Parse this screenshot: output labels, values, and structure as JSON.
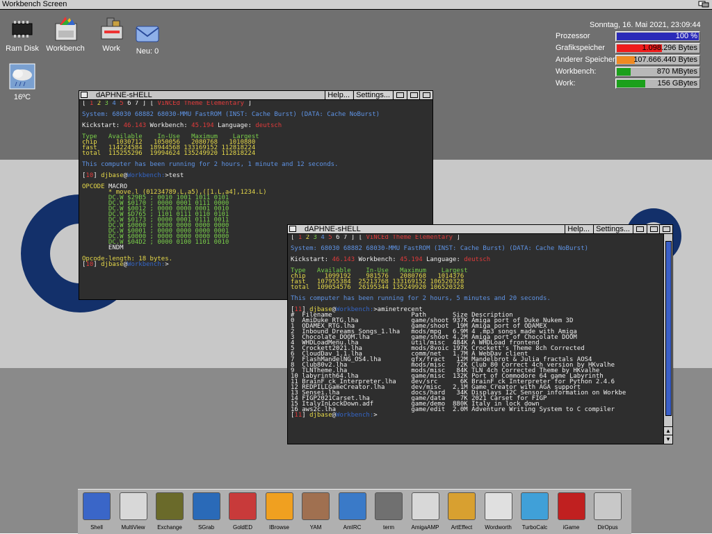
{
  "screen": {
    "title": "Workbench Screen"
  },
  "desktop_icons": [
    {
      "label": "Ram Disk",
      "icon": "ramdisk-chip-icon"
    },
    {
      "label": "Workbench",
      "icon": "workbench-disk-icon"
    },
    {
      "label": "Work",
      "icon": "work-harddisk-icon"
    },
    {
      "label": "Neu: 0",
      "icon": "mail-envelope-icon"
    },
    {
      "label": "16ºC",
      "icon": "weather-cloud-icon"
    }
  ],
  "monitor": {
    "datetime": "Sonntag, 16. Mai 2021, 23:09:44",
    "rows": [
      {
        "label": "Prozessor",
        "value": "100 %",
        "fill": 1.0,
        "color": "#2b2bb8"
      },
      {
        "label": "Grafikspeicher",
        "value": "1.098.296 Bytes",
        "fill": 0.55,
        "color": "#ef1b1b"
      },
      {
        "label": "Anderer Speicher",
        "value": "107.666.440 Bytes",
        "fill": 0.22,
        "color": "#f08a22"
      },
      {
        "label": "Workbench:",
        "value": "870 MBytes",
        "fill": 0.17,
        "color": "#1ba01b"
      },
      {
        "label": "Work:",
        "value": "156 GBytes",
        "fill": 0.35,
        "color": "#1ba01b"
      }
    ]
  },
  "windows": [
    {
      "title": "dAPHNE-sHELL",
      "help": "Help...",
      "settings": "Settings...",
      "lines": [
        {
          "segs": [
            [
              "[ ",
              "c-wht"
            ],
            [
              "1 ",
              "c-red"
            ],
            [
              "2 ",
              "c-yel"
            ],
            [
              "3 ",
              "c-grn"
            ],
            [
              "4 ",
              "c-blue"
            ],
            [
              "5 ",
              "c-red"
            ],
            [
              "6 ",
              "c-wht"
            ],
            [
              "7 ",
              "c-wht"
            ],
            [
              "] [ ",
              "c-wht"
            ],
            [
              "ViNCEd Theme Elementary",
              "c-red"
            ],
            [
              " ]",
              "c-wht"
            ]
          ]
        },
        {
          "segs": [
            [
              "",
              ""
            ]
          ]
        },
        {
          "segs": [
            [
              "System: 68030 68882 68030-MMU FastROM (INST: Cache Burst) (DATA: Cache NoBurst)",
              "c-blue"
            ]
          ]
        },
        {
          "segs": [
            [
              "",
              ""
            ]
          ]
        },
        {
          "segs": [
            [
              "Kickstart: ",
              "c-wht"
            ],
            [
              "46.143",
              "c-red"
            ],
            [
              " Workbench: ",
              "c-wht"
            ],
            [
              "45.194",
              "c-red"
            ],
            [
              " Language: ",
              "c-wht"
            ],
            [
              "deutsch",
              "c-red"
            ]
          ]
        },
        {
          "segs": [
            [
              "",
              ""
            ]
          ]
        },
        {
          "segs": [
            [
              "Type   Available    In-Use   Maximum    Largest",
              "c-grn"
            ]
          ]
        },
        {
          "segs": [
            [
              "chip     1030712   1050056   2080768   1010880",
              "c-yel"
            ]
          ]
        },
        {
          "segs": [
            [
              "fast   114224584  18944568 133169152 112818224",
              "c-yel"
            ]
          ]
        },
        {
          "segs": [
            [
              "total  115255296  19994624 135249920 112818224",
              "c-yel"
            ]
          ]
        },
        {
          "segs": [
            [
              "",
              ""
            ]
          ]
        },
        {
          "segs": [
            [
              "This computer has been running for 2 hours, 1 minute and 12 seconds.",
              "c-blue"
            ]
          ]
        },
        {
          "segs": [
            [
              "",
              ""
            ]
          ]
        },
        {
          "segs": [
            [
              "[",
              "c-wht"
            ],
            [
              "10",
              "c-red"
            ],
            [
              "] ",
              "c-wht"
            ],
            [
              "djbase",
              "c-yel"
            ],
            [
              "@",
              "c-wht"
            ],
            [
              "Workbench:",
              "c-dblue"
            ],
            [
              ">test",
              "c-wht"
            ]
          ]
        },
        {
          "segs": [
            [
              "",
              ""
            ]
          ]
        },
        {
          "segs": [
            [
              "OPCODE ",
              "c-yel"
            ],
            [
              "MACRO",
              "c-wht"
            ]
          ]
        },
        {
          "segs": [
            [
              "       * move.l (01234789.L,a5),([1.L,a4],1234.L)",
              "c-yel"
            ]
          ]
        },
        {
          "segs": [
            [
              "       DC.W $29B5 ; 0010 1001 1011 0101",
              "c-grn"
            ]
          ]
        },
        {
          "segs": [
            [
              "       DC.W $0170 ; 0000 0001 0111 0000",
              "c-grn"
            ]
          ]
        },
        {
          "segs": [
            [
              "       DC.W $0012 ; 0000 0000 0001 0010",
              "c-grn"
            ]
          ]
        },
        {
          "segs": [
            [
              "       DC.W $D765 ; 1101 0111 0110 0101",
              "c-grn"
            ]
          ]
        },
        {
          "segs": [
            [
              "       DC.W $0173 ; 0000 0001 0111 0011",
              "c-grn"
            ]
          ]
        },
        {
          "segs": [
            [
              "       DC.W $0000 ; 0000 0000 0000 0000",
              "c-grn"
            ]
          ]
        },
        {
          "segs": [
            [
              "       DC.W $0001 ; 0000 0000 0000 0001",
              "c-grn"
            ]
          ]
        },
        {
          "segs": [
            [
              "       DC.W $0000 ; 0000 0000 0000 0000",
              "c-grn"
            ]
          ]
        },
        {
          "segs": [
            [
              "       DC.W $04D2 ; 0000 0100 1101 0010",
              "c-grn"
            ]
          ]
        },
        {
          "segs": [
            [
              "       ENDM",
              "c-wht"
            ]
          ]
        },
        {
          "segs": [
            [
              "",
              ""
            ]
          ]
        },
        {
          "segs": [
            [
              "Opcode-length: ",
              "c-yel"
            ],
            [
              "18 bytes.",
              "c-yel"
            ]
          ]
        },
        {
          "segs": [
            [
              "[",
              "c-wht"
            ],
            [
              "10",
              "c-red"
            ],
            [
              "] ",
              "c-wht"
            ],
            [
              "djbase",
              "c-yel"
            ],
            [
              "@",
              "c-wht"
            ],
            [
              "Workbench:",
              "c-dblue"
            ],
            [
              ">",
              "c-wht"
            ]
          ]
        }
      ]
    },
    {
      "title": "dAPHNE-sHELL",
      "help": "Help...",
      "settings": "Settings...",
      "lines": [
        {
          "segs": [
            [
              "[ ",
              "c-wht"
            ],
            [
              "1 ",
              "c-red"
            ],
            [
              "2 ",
              "c-yel"
            ],
            [
              "3 ",
              "c-grn"
            ],
            [
              "4 ",
              "c-blue"
            ],
            [
              "5 ",
              "c-red"
            ],
            [
              "6 ",
              "c-wht"
            ],
            [
              "7 ",
              "c-wht"
            ],
            [
              "] [ ",
              "c-wht"
            ],
            [
              "ViNCEd Theme Elementary",
              "c-red"
            ],
            [
              " ]",
              "c-wht"
            ]
          ]
        },
        {
          "segs": [
            [
              "",
              ""
            ]
          ]
        },
        {
          "segs": [
            [
              "System: 68030 68882 68030-MMU FastROM (INST: Cache Burst) (DATA: Cache NoBurst)",
              "c-blue"
            ]
          ]
        },
        {
          "segs": [
            [
              "",
              ""
            ]
          ]
        },
        {
          "segs": [
            [
              "Kickstart: ",
              "c-wht"
            ],
            [
              "46.143",
              "c-red"
            ],
            [
              " Workbench: ",
              "c-wht"
            ],
            [
              "45.194",
              "c-red"
            ],
            [
              " Language: ",
              "c-wht"
            ],
            [
              "deutsch",
              "c-red"
            ]
          ]
        },
        {
          "segs": [
            [
              "",
              ""
            ]
          ]
        },
        {
          "segs": [
            [
              "Type   Available    In-Use   Maximum    Largest",
              "c-grn"
            ]
          ]
        },
        {
          "segs": [
            [
              "chip     1099192    981576   2080768   1014376",
              "c-yel"
            ]
          ]
        },
        {
          "segs": [
            [
              "fast   107955384  25213768 133169152 106520328",
              "c-yel"
            ]
          ]
        },
        {
          "segs": [
            [
              "total  109054576  26195344 135249920 106520328",
              "c-yel"
            ]
          ]
        },
        {
          "segs": [
            [
              "",
              ""
            ]
          ]
        },
        {
          "segs": [
            [
              "This computer has been running for 2 hours, 5 minutes and 20 seconds.",
              "c-blue"
            ]
          ]
        },
        {
          "segs": [
            [
              "",
              ""
            ]
          ]
        },
        {
          "segs": [
            [
              "[",
              "c-wht"
            ],
            [
              "11",
              "c-red"
            ],
            [
              "] ",
              "c-wht"
            ],
            [
              "djbase",
              "c-yel"
            ],
            [
              "@",
              "c-wht"
            ],
            [
              "Workbench:",
              "c-dblue"
            ],
            [
              ">aminetrecent",
              "c-wht"
            ]
          ]
        },
        {
          "segs": [
            [
              "#  Filename                     Path       Size Description",
              "c-wht"
            ]
          ]
        },
        {
          "segs": [
            [
              "0  AmiDuke_RTG.lha              game/shoot 937K Amiga port of Duke Nukem 3D",
              "c-wht"
            ]
          ]
        },
        {
          "segs": [
            [
              "1  ODAMEX_RTG.lha               game/shoot  19M Amiga port of ODAMEX",
              "c-wht"
            ]
          ]
        },
        {
          "segs": [
            [
              "2  Inbound_Dreams_Songs_1.lha   mods/mpg   6.9M 4 .mp3 songs made with Amiga",
              "c-wht"
            ]
          ]
        },
        {
          "segs": [
            [
              "3  Chocolate_DOOM.lha           game/shoot 4.2M Amiga port of Chocolate DOOM",
              "c-wht"
            ]
          ]
        },
        {
          "segs": [
            [
              "4  WHDLoadMenu.lha              util/misc  484K A WHDLoad frontend",
              "c-wht"
            ]
          ]
        },
        {
          "segs": [
            [
              "5  Crockett2021.lha             mods/8voic 197K Crockett's Theme 8ch Corrected",
              "c-wht"
            ]
          ]
        },
        {
          "segs": [
            [
              "6  CloudDav_1.1.lha             comm/net   1.7M A WebDav client",
              "c-wht"
            ]
          ]
        },
        {
          "segs": [
            [
              "7  FlashMandelNG_OS4.lha        gfx/fract   12M Mandelbrot & Julia fractals AOS4",
              "c-wht"
            ]
          ]
        },
        {
          "segs": [
            [
              "8  Club80v2.lha                 mods/misc   72K Club 80 Correct 4ch version by HKvalhe",
              "c-wht"
            ]
          ]
        },
        {
          "segs": [
            [
              "9  TLNTheme.lha                 mods/misc   84K TLN 4ch Corrected Theme by HKvalhe",
              "c-wht"
            ]
          ]
        },
        {
          "segs": [
            [
              "10 labyrinth64.lha              game/misc  132K Port of Commodore 64 game Labyrinth",
              "c-wht"
            ]
          ]
        },
        {
          "segs": [
            [
              "11 BrainF_ck_Interpreter.lha    dev/src      6K BrainF_ck Interpreter for Python 2.4.6",
              "c-wht"
            ]
          ]
        },
        {
          "segs": [
            [
              "12 REDPILLGameCreator.lha       dev/misc   2.1M Game Creator with AGA support",
              "c-wht"
            ]
          ]
        },
        {
          "segs": [
            [
              "13 Sensei.lha                   docs/hard   34K Displays I2C Sensor information on Workbe",
              "c-wht"
            ]
          ]
        },
        {
          "segs": [
            [
              "14 FIGP2021Carset.lha           game/data    7K 2021 Carset for FIGP",
              "c-wht"
            ]
          ]
        },
        {
          "segs": [
            [
              "15 ItalyInLockDown.adf          game/demo  880K Italy in lock down",
              "c-wht"
            ]
          ]
        },
        {
          "segs": [
            [
              "16 aws2c.lha                    game/edit  2.0M Adventure Writing System to C compiler",
              "c-wht"
            ]
          ]
        },
        {
          "segs": [
            [
              "[",
              "c-wht"
            ],
            [
              "11",
              "c-red"
            ],
            [
              "] ",
              "c-wht"
            ],
            [
              "djbase",
              "c-yel"
            ],
            [
              "@",
              "c-wht"
            ],
            [
              "Workbench:",
              "c-dblue"
            ],
            [
              ">",
              "c-wht"
            ]
          ]
        }
      ]
    }
  ],
  "dock": [
    {
      "label": "Shell",
      "icon": "shell-icon",
      "color": "#3a66c8"
    },
    {
      "label": "MultiView",
      "icon": "magnifier-icon",
      "color": "#d8d8d8"
    },
    {
      "label": "Exchange",
      "icon": "exchange-icon",
      "color": "#6a6a2a"
    },
    {
      "label": "SGrab",
      "icon": "screengrab-icon",
      "color": "#2a6ab8"
    },
    {
      "label": "GoldED",
      "icon": "golded-icon",
      "color": "#c83a3a"
    },
    {
      "label": "IBrowse",
      "icon": "ibrowse-icon",
      "color": "#f0a020"
    },
    {
      "label": "YAM",
      "icon": "yam-icon",
      "color": "#a07050"
    },
    {
      "label": "AmIRC",
      "icon": "amirc-icon",
      "color": "#3a7ac8"
    },
    {
      "label": "term",
      "icon": "term-icon",
      "color": "#707070"
    },
    {
      "label": "AmigaAMP",
      "icon": "amigaamp-icon",
      "color": "#d8d8d8"
    },
    {
      "label": "ArtEffect",
      "icon": "arteffect-icon",
      "color": "#d8a030"
    },
    {
      "label": "Wordworth",
      "icon": "wordworth-icon",
      "color": "#e0e0e0"
    },
    {
      "label": "TurboCalc",
      "icon": "turbocalc-icon",
      "color": "#40a0d8"
    },
    {
      "label": "iGame",
      "icon": "joystick-icon",
      "color": "#c02020"
    },
    {
      "label": "DirOpus",
      "icon": "diropus-icon",
      "color": "#c8c8c8"
    }
  ]
}
